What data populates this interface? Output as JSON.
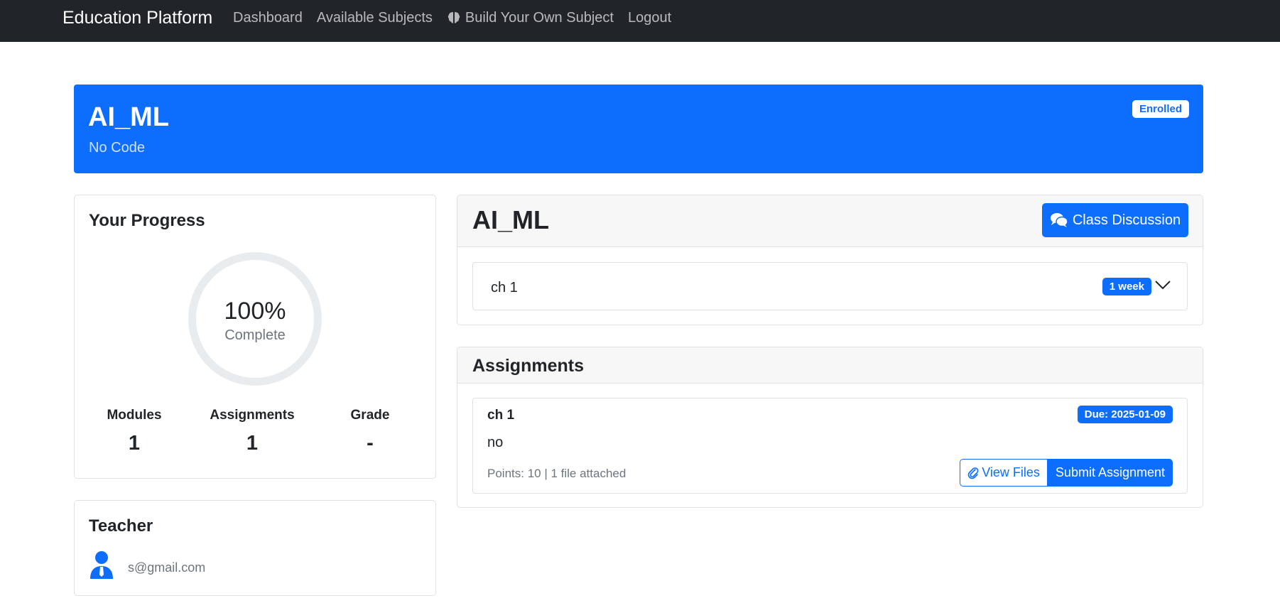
{
  "navbar": {
    "brand": "Education Platform",
    "links": [
      "Dashboard",
      "Available Subjects",
      "Build Your Own Subject",
      "Logout"
    ],
    "icons": {
      "build": "brain-icon"
    }
  },
  "banner": {
    "title": "AI_ML",
    "code": "No Code",
    "badge": "Enrolled"
  },
  "progress": {
    "title": "Your Progress",
    "percent_text": "100%",
    "percent_value": 100,
    "complete_label": "Complete",
    "stats": [
      {
        "label": "Modules",
        "value": "1"
      },
      {
        "label": "Assignments",
        "value": "1"
      },
      {
        "label": "Grade",
        "value": "-"
      }
    ]
  },
  "teacher": {
    "title": "Teacher",
    "email": "s@gmail.com",
    "icon": "user-tie-icon"
  },
  "modules": {
    "title": "AI_ML",
    "discussion_button": "Class Discussion",
    "items": [
      {
        "label": "ch 1",
        "badge": "1 week",
        "expanded": false
      }
    ]
  },
  "assignments": {
    "title": "Assignments",
    "items": [
      {
        "name": "ch 1",
        "due": "Due: 2025-01-09",
        "description": "no",
        "meta": "Points: 10 | 1 file attached",
        "view_files": "View Files",
        "submit": "Submit Assignment"
      }
    ]
  },
  "colors": {
    "primary": "#0d6efd",
    "navbar": "#212529",
    "muted": "#6c757d"
  }
}
